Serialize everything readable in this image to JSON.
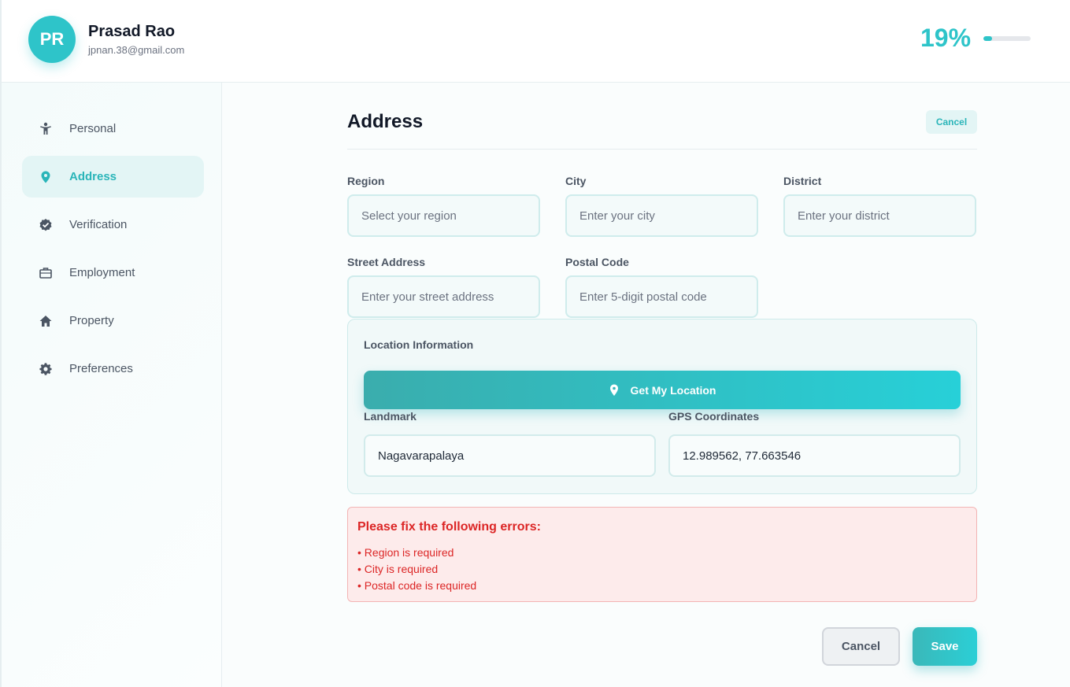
{
  "header": {
    "avatar_initials": "PR",
    "user_name": "Prasad Rao",
    "user_email": "jpnan.38@gmail.com",
    "progress_label": "19%",
    "progress_value": 19
  },
  "sidebar": {
    "items": [
      {
        "label": "Personal",
        "icon": "person-icon",
        "active": false
      },
      {
        "label": "Address",
        "icon": "location-pin-icon",
        "active": true
      },
      {
        "label": "Verification",
        "icon": "verified-badge-icon",
        "active": false
      },
      {
        "label": "Employment",
        "icon": "briefcase-icon",
        "active": false
      },
      {
        "label": "Property",
        "icon": "home-icon",
        "active": false
      },
      {
        "label": "Preferences",
        "icon": "gear-icon",
        "active": false
      }
    ]
  },
  "main": {
    "title": "Address",
    "cancel_label": "Cancel",
    "fields": {
      "region": {
        "label": "Region",
        "placeholder": "Select your region",
        "value": ""
      },
      "city": {
        "label": "City",
        "placeholder": "Enter your city",
        "value": ""
      },
      "district": {
        "label": "District",
        "placeholder": "Enter your district",
        "value": ""
      },
      "street": {
        "label": "Street Address",
        "placeholder": "Enter your street address",
        "value": ""
      },
      "postal": {
        "label": "Postal Code",
        "placeholder": "Enter 5-digit postal code",
        "value": ""
      }
    },
    "location": {
      "title": "Location Information",
      "button_label": "Get My Location",
      "landmark": {
        "label": "Landmark",
        "value": "Nagavarapalaya"
      },
      "gps": {
        "label": "GPS Coordinates",
        "value": "12.989562, 77.663546"
      }
    },
    "errors": {
      "title": "Please fix the following errors:",
      "items": [
        "Region is required",
        "City is required",
        "Postal code is required"
      ]
    },
    "footer": {
      "cancel_label": "Cancel",
      "save_label": "Save"
    }
  },
  "colors": {
    "accent": "#2ec4c9",
    "error": "#dc2626",
    "error_bg": "#fdebeb"
  }
}
